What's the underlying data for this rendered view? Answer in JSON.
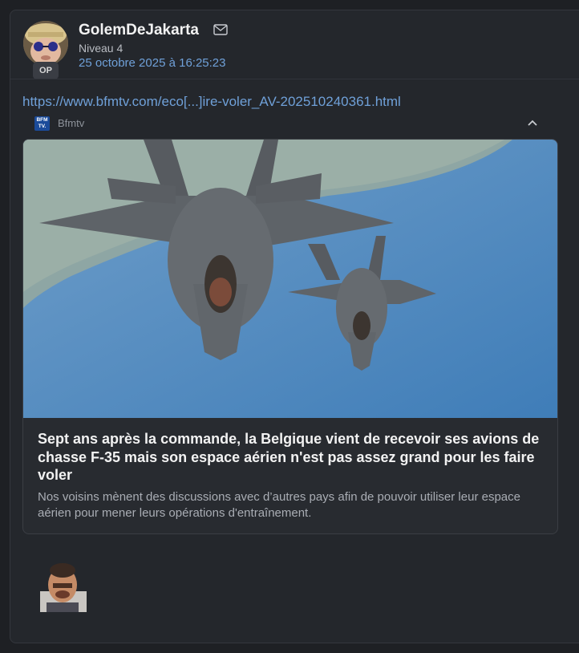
{
  "post": {
    "author": {
      "username": "GolemDeJakarta",
      "level": "Niveau 4",
      "badge": "OP",
      "avatar_icon": "avatar-sunglasses-hat"
    },
    "date": "25 octobre 2025 à 16:25:23",
    "message_icon": "mail-icon",
    "link": "https://www.bfmtv.com/eco[...]ire-voler_AV-202510240361.html",
    "embed": {
      "source_logo_text": "BFM TV.",
      "source_name": "Bfmtv",
      "collapse_icon": "chevron-up-icon",
      "title": "Sept ans après la commande, la Belgique vient de recevoir ses avions de chasse F-35 mais son espace aérien n'est pas assez grand pour les faire voler",
      "description": "Nos voisins mènent des discussions avec d’autres pays afin de pouvoir utiliser leur espace aérien pour mener leurs opérations d'entraînement."
    },
    "reaction_sticker": "laughing-man-sticker"
  },
  "colors": {
    "background": "#1e2024",
    "post_bg": "#24272c",
    "link": "#6fa0d8",
    "text": "#f2f2f2",
    "muted": "#a9adb4"
  }
}
